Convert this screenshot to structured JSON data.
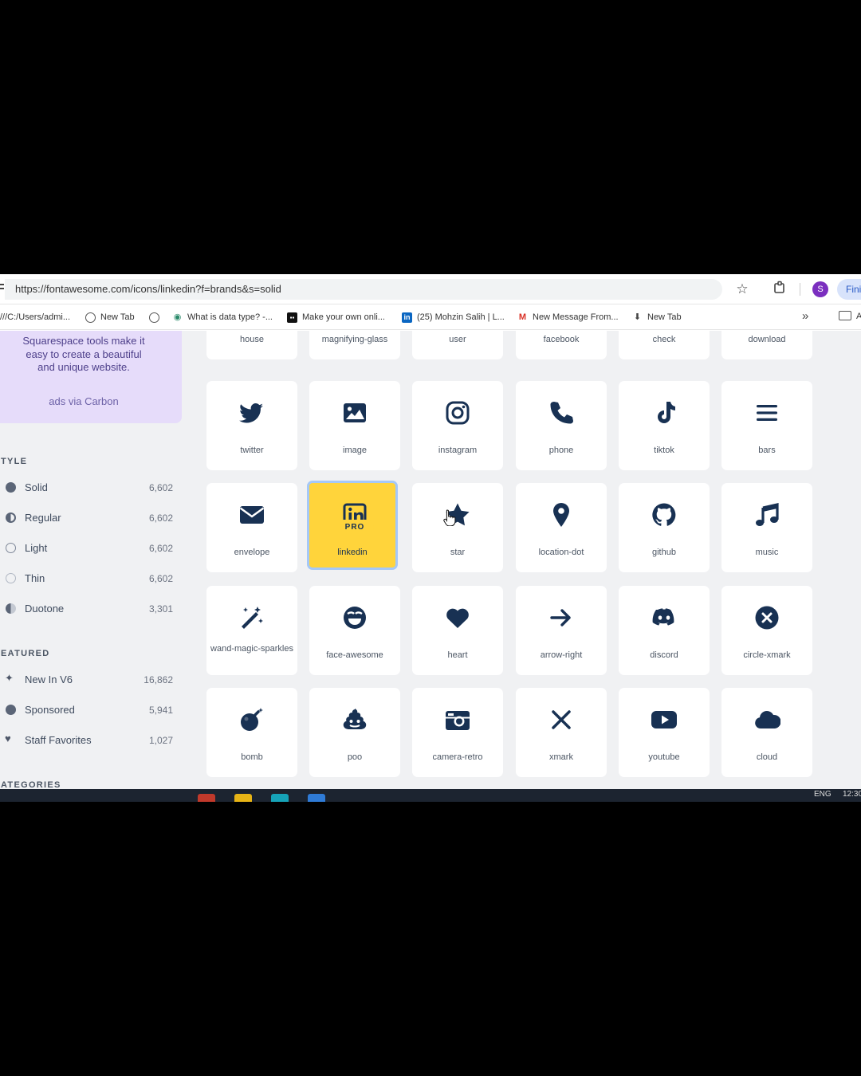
{
  "browser": {
    "url": "https://fontawesome.com/icons/linkedin?f=brands&s=solid",
    "profile_initial": "S",
    "finish_label": "Fini",
    "star_icon": "star-icon",
    "extensions_icon": "puzzle-icon"
  },
  "bookmarks": [
    {
      "label": "///C:/Users/admi...",
      "icon": "none"
    },
    {
      "label": "New Tab",
      "icon": "globe-icon"
    },
    {
      "label": "",
      "icon": "globe-icon"
    },
    {
      "label": "What is data type? -...",
      "icon": "eye-icon"
    },
    {
      "label": "Make your own onli...",
      "icon": "dk-icon"
    },
    {
      "label": "(25) Mohzin Salih | L...",
      "icon": "linkedin-icon"
    },
    {
      "label": "New Message From...",
      "icon": "gmail-icon"
    },
    {
      "label": "New Tab",
      "icon": "download-icon"
    }
  ],
  "bookmarks_folder_label": "A",
  "ad": {
    "text": "Squarespace tools make it easy to create a beautiful and unique website.",
    "via": "ads via Carbon"
  },
  "sidebar": {
    "style_heading": "TYLE",
    "styles": [
      {
        "label": "Solid",
        "count": "6,602"
      },
      {
        "label": "Regular",
        "count": "6,602"
      },
      {
        "label": "Light",
        "count": "6,602"
      },
      {
        "label": "Thin",
        "count": "6,602"
      },
      {
        "label": "Duotone",
        "count": "3,301"
      }
    ],
    "featured_heading": "EATURED",
    "featured": [
      {
        "label": "New In V6",
        "count": "16,862"
      },
      {
        "label": "Sponsored",
        "count": "5,941"
      },
      {
        "label": "Staff Favorites",
        "count": "1,027"
      }
    ],
    "categories_heading": "ATEGORIES"
  },
  "icons_top_row": [
    "house",
    "magnifying-glass",
    "user",
    "facebook",
    "check",
    "download"
  ],
  "icons": [
    [
      "twitter",
      "image",
      "instagram",
      "phone",
      "tiktok",
      "bars"
    ],
    [
      "envelope",
      "linkedin",
      "star",
      "location-dot",
      "github",
      "music"
    ],
    [
      "wand-magic-sparkles",
      "face-awesome",
      "heart",
      "arrow-right",
      "discord",
      "circle-xmark"
    ],
    [
      "bomb",
      "poo",
      "camera-retro",
      "xmark",
      "youtube",
      "cloud"
    ]
  ],
  "selected_icon": "linkedin",
  "pro_badge": "PRO",
  "colors": {
    "icon": "#183153",
    "selected": "#ffd43b",
    "ad_bg": "#e6dcfa"
  },
  "taskbar": {
    "lang": "ENG",
    "time": "12:30"
  }
}
